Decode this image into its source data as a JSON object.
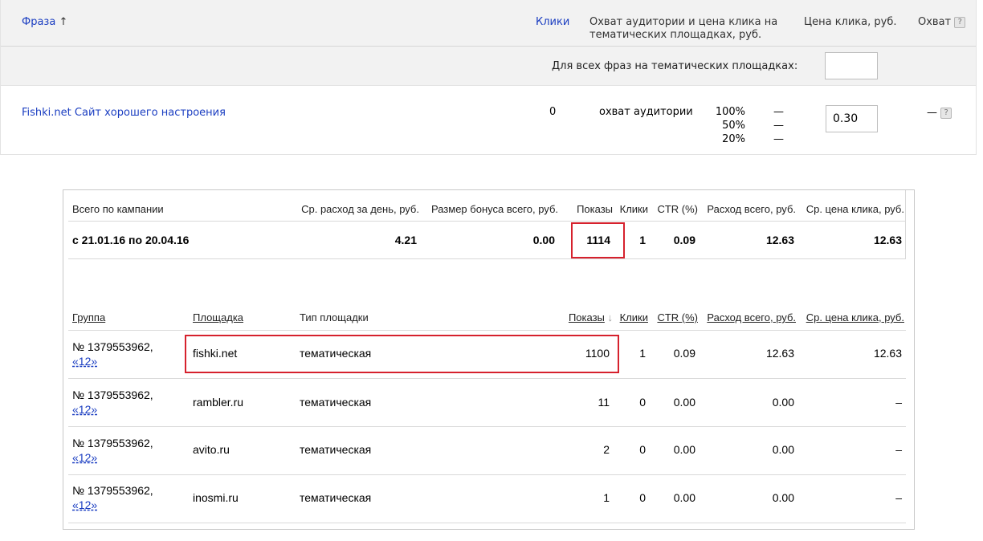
{
  "phrase_table": {
    "headers": {
      "phrase": "Фраза",
      "phrase_sort_arrow": "↑",
      "clicks": "Клики",
      "reach": "Охват аудитории и цена клика на тематических площадках, руб.",
      "price": "Цена клика, руб.",
      "coverage": "Охват"
    },
    "all_phrases_label": "Для всех фраз на тематических площадках:",
    "all_phrases_value": "",
    "row": {
      "phrase": "Fishki.net Сайт хорошего настроения",
      "clicks": "0",
      "reach_label": "охват аудитории",
      "levels": [
        {
          "percent": "100%",
          "value": "—"
        },
        {
          "percent": "50%",
          "value": "—"
        },
        {
          "percent": "20%",
          "value": "—"
        }
      ],
      "price_value": "0.30",
      "coverage": "—"
    },
    "help_icon_glyph": "?"
  },
  "campaign_totals": {
    "headers": [
      "Всего по кампании",
      "Ср. расход за день, руб.",
      "Размер бонуса всего, руб.",
      "Показы",
      "Клики",
      "CTR (%)",
      "Расход всего, руб.",
      "Ср. цена клика, руб."
    ],
    "row": [
      "с 21.01.16 по 20.04.16",
      "4.21",
      "0.00",
      "1114",
      "1",
      "0.09",
      "12.63",
      "12.63"
    ]
  },
  "platforms": {
    "headers": {
      "group": "Группа",
      "platform": "Площадка",
      "type": "Тип площадки",
      "shows": "Показы",
      "shows_sort_arrow": "↓",
      "clicks": "Клики",
      "ctr": "CTR (%)",
      "spend": "Расход всего, руб.",
      "cpc": "Ср. цена клика, руб."
    },
    "rows": [
      {
        "group_no": "№ 1379553962,",
        "group_link": "«12»",
        "platform": "fishki.net",
        "type": "тематическая",
        "shows": "1100",
        "clicks": "1",
        "ctr": "0.09",
        "spend": "12.63",
        "cpc": "12.63"
      },
      {
        "group_no": "№ 1379553962,",
        "group_link": "«12»",
        "platform": "rambler.ru",
        "type": "тематическая",
        "shows": "11",
        "clicks": "0",
        "ctr": "0.00",
        "spend": "0.00",
        "cpc": "–"
      },
      {
        "group_no": "№ 1379553962,",
        "group_link": "«12»",
        "platform": "avito.ru",
        "type": "тематическая",
        "shows": "2",
        "clicks": "0",
        "ctr": "0.00",
        "spend": "0.00",
        "cpc": "–"
      },
      {
        "group_no": "№ 1379553962,",
        "group_link": "«12»",
        "platform": "inosmi.ru",
        "type": "тематическая",
        "shows": "1",
        "clicks": "0",
        "ctr": "0.00",
        "spend": "0.00",
        "cpc": "–"
      }
    ]
  },
  "colors": {
    "link": "#1a3dc1",
    "highlight_box": "#d6212d",
    "header_bg": "#f2f2f2"
  }
}
